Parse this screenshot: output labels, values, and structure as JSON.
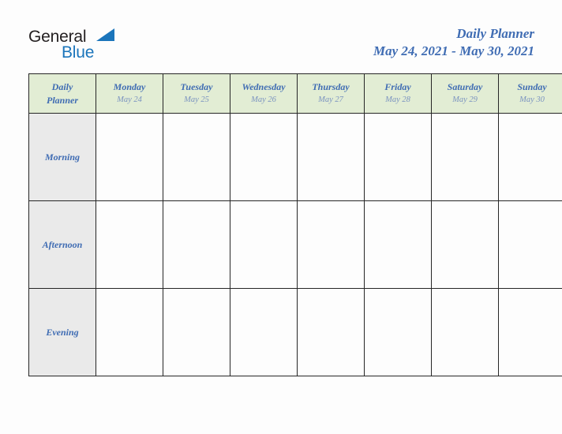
{
  "logo": {
    "primary_text": "General",
    "secondary_text": "Blue",
    "triangle_icon": "triangle-icon",
    "primary_color": "#231f20",
    "secondary_color": "#1b75bb"
  },
  "header": {
    "title": "Daily Planner",
    "date_range": "May 24, 2021 - May 30, 2021",
    "title_color": "#3f6cb3"
  },
  "table": {
    "corner": {
      "line1": "Daily",
      "line2": "Planner"
    },
    "header_background": "#e2edd4",
    "row_label_background": "#eaeaea",
    "border_color": "#262626",
    "columns": [
      {
        "day": "Monday",
        "date": "May 24"
      },
      {
        "day": "Tuesday",
        "date": "May 25"
      },
      {
        "day": "Wednesday",
        "date": "May 26"
      },
      {
        "day": "Thursday",
        "date": "May 27"
      },
      {
        "day": "Friday",
        "date": "May 28"
      },
      {
        "day": "Saturday",
        "date": "May 29"
      },
      {
        "day": "Sunday",
        "date": "May 30"
      }
    ],
    "rows": [
      {
        "label": "Morning",
        "cells": [
          "",
          "",
          "",
          "",
          "",
          "",
          ""
        ]
      },
      {
        "label": "Afternoon",
        "cells": [
          "",
          "",
          "",
          "",
          "",
          "",
          ""
        ]
      },
      {
        "label": "Evening",
        "cells": [
          "",
          "",
          "",
          "",
          "",
          "",
          ""
        ]
      }
    ]
  }
}
